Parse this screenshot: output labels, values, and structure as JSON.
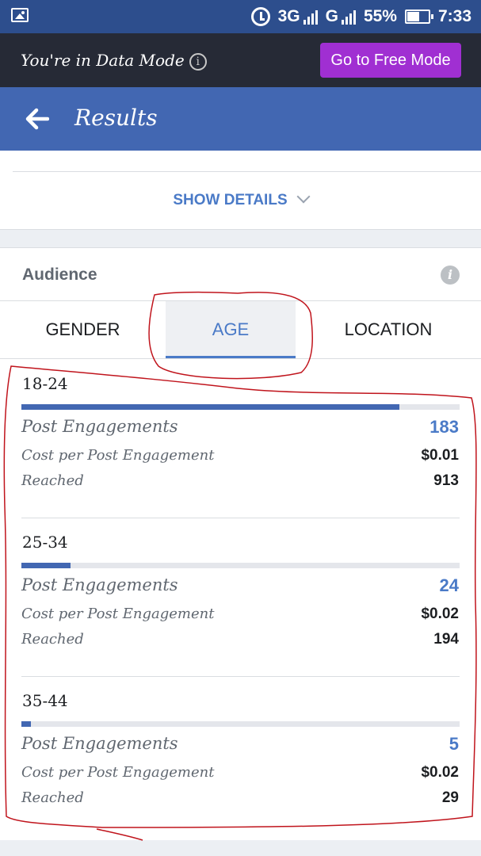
{
  "status_bar": {
    "network": "3G",
    "network2": "G",
    "battery": "55%",
    "time": "7:33"
  },
  "mode_bar": {
    "text": "You're in Data Mode",
    "button": "Go to Free Mode"
  },
  "header": {
    "title": "Results"
  },
  "details": {
    "show_details": "SHOW DETAILS"
  },
  "audience": {
    "title": "Audience",
    "tabs": [
      "GENDER",
      "AGE",
      "LOCATION"
    ],
    "active_tab": "AGE",
    "groups": [
      {
        "age": "18-24",
        "bar_fraction": 0.863,
        "post_engagements_label": "Post Engagements",
        "post_engagements": "183",
        "cost_label": "Cost per Post Engagement",
        "cost": "$0.01",
        "reached_label": "Reached",
        "reached": "913"
      },
      {
        "age": "25-34",
        "bar_fraction": 0.112,
        "post_engagements_label": "Post Engagements",
        "post_engagements": "24",
        "cost_label": "Cost per Post Engagement",
        "cost": "$0.02",
        "reached_label": "Reached",
        "reached": "194"
      },
      {
        "age": "35-44",
        "bar_fraction": 0.022,
        "post_engagements_label": "Post Engagements",
        "post_engagements": "5",
        "cost_label": "Cost per Post Engagement",
        "cost": "$0.02",
        "reached_label": "Reached",
        "reached": "29"
      }
    ]
  },
  "colors": {
    "status_bar": "#2d4e8d",
    "mode_bar": "#262a36",
    "free_button": "#a02fd2",
    "header": "#4267b2",
    "accent": "#4a7ac7",
    "annotation": "#c0141c"
  }
}
